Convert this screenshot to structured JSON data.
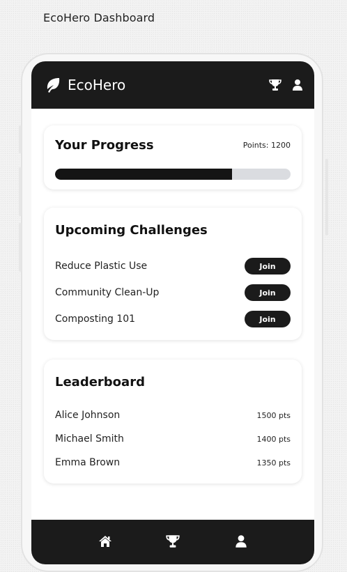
{
  "page": {
    "title": "EcoHero Dashboard"
  },
  "header": {
    "brand_name": "EcoHero",
    "icons": [
      "leaf-icon",
      "trophy-icon",
      "user-icon"
    ]
  },
  "progress": {
    "title": "Your Progress",
    "points_label": "Points: 1200",
    "percent": 75
  },
  "challenges": {
    "title": "Upcoming Challenges",
    "items": [
      {
        "name": "Reduce Plastic Use",
        "button": "Join"
      },
      {
        "name": "Community Clean-Up",
        "button": "Join"
      },
      {
        "name": "Composting 101",
        "button": "Join"
      }
    ]
  },
  "leaderboard": {
    "title": "Leaderboard",
    "rows": [
      {
        "name": "Alice Johnson",
        "points": "1500 pts"
      },
      {
        "name": "Michael Smith",
        "points": "1400 pts"
      },
      {
        "name": "Emma Brown",
        "points": "1350 pts"
      }
    ]
  },
  "bottom_nav": {
    "items": [
      "home-icon",
      "trophy-icon",
      "user-icon"
    ]
  },
  "colors": {
    "dark": "#1b1b1b",
    "track": "#dadce0",
    "card": "#ffffff"
  }
}
